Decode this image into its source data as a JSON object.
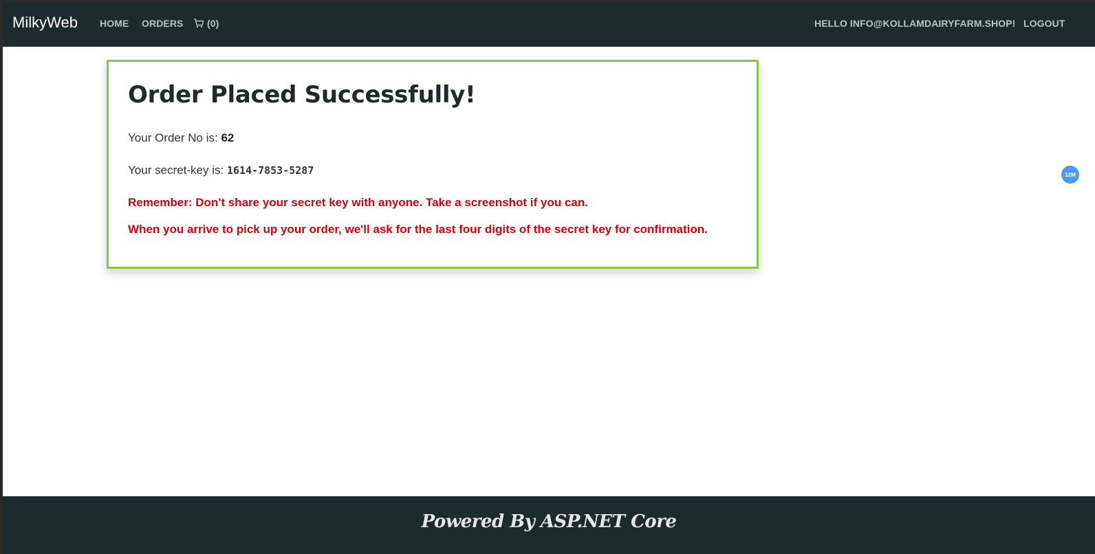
{
  "navbar": {
    "brand": "MilkyWeb",
    "links": {
      "home": "HOME",
      "orders": "ORDERS",
      "cart": "(0)"
    },
    "greeting": "HELLO INFO@KOLLAMDAIRYFARM.SHOP!",
    "logout": "LOGOUT"
  },
  "card": {
    "title": "Order Placed Successfully!",
    "order_prefix": "Your Order No is: ",
    "order_no": "62",
    "key_prefix": "Your secret-key is: ",
    "secret_key": "1614-7853-5287",
    "warning_1": "Remember: Don't share your secret key with anyone. Take a screenshot if you can.",
    "warning_2": "When you arrive to pick up your order, we'll ask for the last four digits of the secret key for confirmation."
  },
  "side_badge": "12M",
  "footer": {
    "text": "Powered By ASP.NET Core"
  },
  "colors": {
    "navbar_bg": "#1d2b2f",
    "card_border": "#8bc34a",
    "warning": "#d9000d",
    "badge": "#4c9bf0"
  },
  "icons": {
    "cart": "cart-icon"
  }
}
